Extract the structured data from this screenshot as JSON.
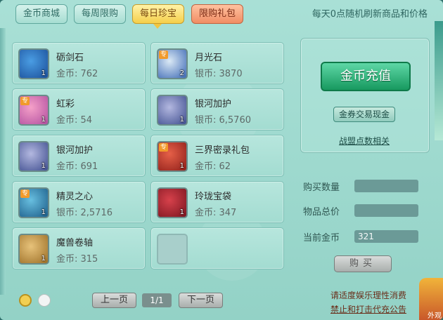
{
  "tabs": [
    {
      "label": "金币商城",
      "state": "normal"
    },
    {
      "label": "每周限购",
      "state": "normal"
    },
    {
      "label": "每日珍宝",
      "state": "active"
    },
    {
      "label": "限购礼包",
      "state": "gift"
    }
  ],
  "refresh_note": "每天0点随机刷新商品和价格",
  "items": [
    {
      "name": "砺剑石",
      "price": "金币: 762",
      "count": "1",
      "badge": "",
      "icon": "blue-crystal-icon"
    },
    {
      "name": "月光石",
      "price": "银币: 3870",
      "count": "2",
      "badge": "专",
      "icon": "moonstone-icon"
    },
    {
      "name": "虹彩",
      "price": "金币: 54",
      "count": "1",
      "badge": "专",
      "icon": "potion-bottle-icon"
    },
    {
      "name": "银河加护",
      "price": "银币: 6,5760",
      "count": "1",
      "badge": "",
      "icon": "necklace-icon"
    },
    {
      "name": "银河加护",
      "price": "金币: 691",
      "count": "1",
      "badge": "",
      "icon": "necklace-icon"
    },
    {
      "name": "三界密录礼包",
      "price": "金币: 62",
      "count": "1",
      "badge": "专",
      "icon": "gift-bag-icon"
    },
    {
      "name": "精灵之心",
      "price": "银币: 2,5716",
      "count": "1",
      "badge": "专",
      "icon": "spirit-heart-icon"
    },
    {
      "name": "玲珑宝袋",
      "price": "金币: 347",
      "count": "1",
      "badge": "",
      "icon": "treasure-pouch-icon"
    },
    {
      "name": "魔兽卷轴",
      "price": "金币: 315",
      "count": "1",
      "badge": "",
      "icon": "scroll-icon"
    }
  ],
  "right_panel": {
    "recharge_label": "金币充值",
    "exchange_label": "金券交易现金",
    "alliance_link": "战盟点数相关",
    "qty_label": "购买数量",
    "total_label": "物品总价",
    "gold_label": "当前金币",
    "qty_value": "",
    "total_value": "",
    "gold_value": "321",
    "buy_label": "购买"
  },
  "pagination": {
    "prev_label": "上一页",
    "page": "1/1",
    "next_label": "下一页"
  },
  "notices": {
    "line1": "请适度娱乐理性消费",
    "line2": "禁止和打击代充公告"
  },
  "mascot_text": "外观"
}
